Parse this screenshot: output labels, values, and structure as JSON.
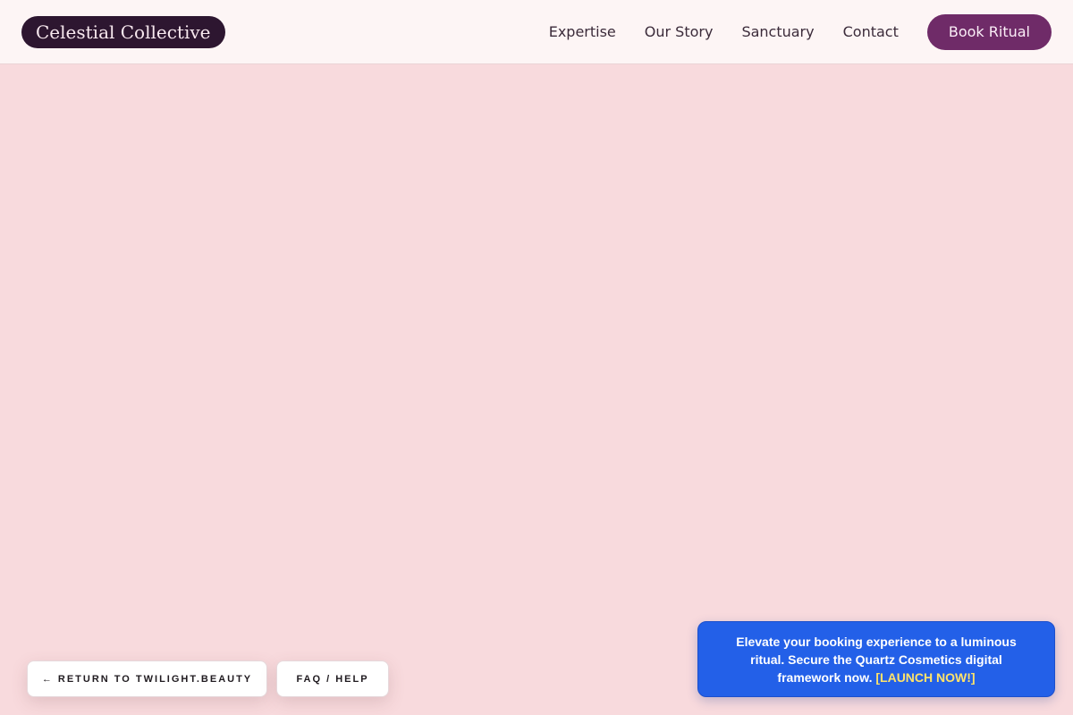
{
  "brand": {
    "name": "Celestial Collective"
  },
  "nav": {
    "links": [
      {
        "label": "Expertise"
      },
      {
        "label": "Our Story"
      },
      {
        "label": "Sanctuary"
      },
      {
        "label": "Contact"
      }
    ],
    "cta_label": "Book Ritual"
  },
  "footer_buttons": {
    "return_label": "← RETURN TO TWILIGHT.BEAUTY",
    "faq_label": "FAQ / HELP"
  },
  "promo": {
    "text": "Elevate your booking experience to a luminous ritual. Secure the Quartz Cosmetics digital framework now.",
    "link_label": "[LAUNCH NOW!]"
  },
  "colors": {
    "page_background": "#f8dadd",
    "header_background": "#fdf5f5",
    "logo_background": "#2d1630",
    "cta_background": "#6f2b68",
    "promo_background": "#2360e8",
    "promo_link": "#ffe36a"
  }
}
